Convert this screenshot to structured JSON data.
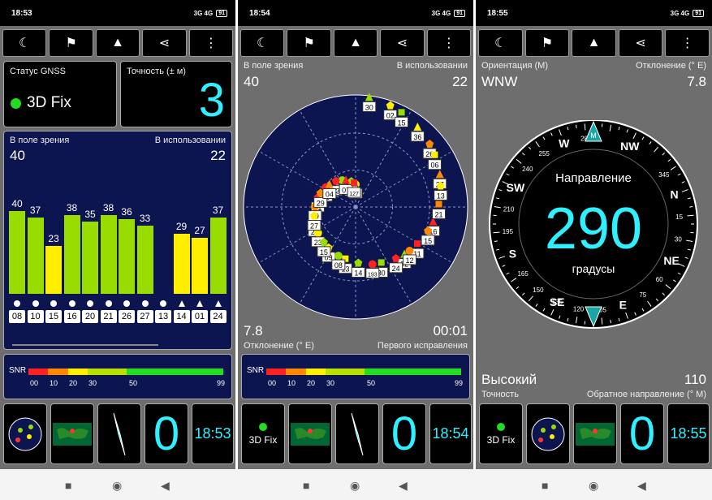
{
  "colors": {
    "accent": "#2ef0ff",
    "bar_green": "#99dd00",
    "bar_yellow": "#ffee00",
    "fix_green": "#22dd22",
    "sky_bg": "#0d1550"
  },
  "toolbar": {
    "icons": [
      "moon-icon",
      "map-person-icon",
      "navigation-arrow-icon",
      "share-icon",
      "more-vert-icon"
    ]
  },
  "phone1": {
    "time": "18:53",
    "network": "3G 4G",
    "battery": "91",
    "gnss_status_label": "Статус GNSS",
    "fix_text": "3D Fix",
    "accuracy_label": "Точность (± м)",
    "accuracy_value": "3",
    "in_view_label": "В поле зрения",
    "in_use_label": "В использовании",
    "in_view": "40",
    "in_use": "22",
    "bars": [
      {
        "prn": "08",
        "snr": "40",
        "color": "green"
      },
      {
        "prn": "10",
        "snr": "37",
        "color": "green"
      },
      {
        "prn": "15",
        "snr": "23",
        "color": "yellow"
      },
      {
        "prn": "16",
        "snr": "38",
        "color": "green"
      },
      {
        "prn": "20",
        "snr": "35",
        "color": "green"
      },
      {
        "prn": "21",
        "snr": "38",
        "color": "green"
      },
      {
        "prn": "26",
        "snr": "36",
        "color": "green"
      },
      {
        "prn": "27",
        "snr": "33",
        "color": "green"
      },
      {
        "prn": "13",
        "snr": "",
        "color": "none"
      },
      {
        "prn": "14",
        "snr": "29",
        "color": "yellow"
      },
      {
        "prn": "01",
        "snr": "27",
        "color": "yellow"
      },
      {
        "prn": "24",
        "snr": "37",
        "color": "green"
      }
    ],
    "snr_label": "SNR",
    "snr_ticks": [
      "00",
      "10",
      "20",
      "30",
      "50",
      "99"
    ],
    "tiles": {
      "zero": "0",
      "time": "18:53"
    }
  },
  "phone2": {
    "time": "18:54",
    "network": "3G 4G",
    "battery": "91",
    "in_view_label": "В поле зрения",
    "in_use_label": "В использовании",
    "in_view": "40",
    "in_use": "22",
    "declination": "7.8",
    "declination_label": "Отклонение (° E)",
    "ttff": "00:01",
    "ttff_label": "Первого исправления",
    "sats": [
      "20",
      "02",
      "01",
      "26",
      "13",
      "05",
      "16",
      "28",
      "02",
      "30",
      "08",
      "27",
      "09",
      "20",
      "11",
      "09",
      "36",
      "14",
      "13",
      "21",
      "23",
      "30",
      "24",
      "29",
      "06",
      "08",
      "07",
      "15",
      "27",
      "15",
      "193",
      "04",
      "13",
      "15",
      "127",
      "12"
    ],
    "snr_label": "SNR",
    "snr_ticks": [
      "00",
      "10",
      "20",
      "30",
      "50",
      "99"
    ],
    "tiles": {
      "fix": "3D Fix",
      "zero": "0",
      "time": "18:54"
    }
  },
  "phone3": {
    "time": "18:55",
    "network": "3G 4G",
    "battery": "91",
    "orientation_label": "Ориентация (M)",
    "orientation_value": "WNW",
    "declination_label": "Отклонение (° E)",
    "declination": "7.8",
    "heading_label": "Направление",
    "heading_value": "290",
    "heading_unit": "градусы",
    "compass_letters": [
      "W",
      "NW",
      "SW",
      "S",
      "SE",
      "E",
      "NE",
      "N"
    ],
    "compass_degrees": [
      "285",
      "255",
      "345",
      "240",
      "15",
      "210",
      "195",
      "30",
      "165",
      "60",
      "150",
      "75",
      "135",
      "120",
      "105",
      "M"
    ],
    "accuracy_word": "Высокий",
    "accuracy_label": "Точность",
    "reverse_value": "110",
    "reverse_label": "Обратное направление (° M)",
    "tiles": {
      "fix": "3D Fix",
      "zero": "0",
      "time": "18:55"
    }
  }
}
